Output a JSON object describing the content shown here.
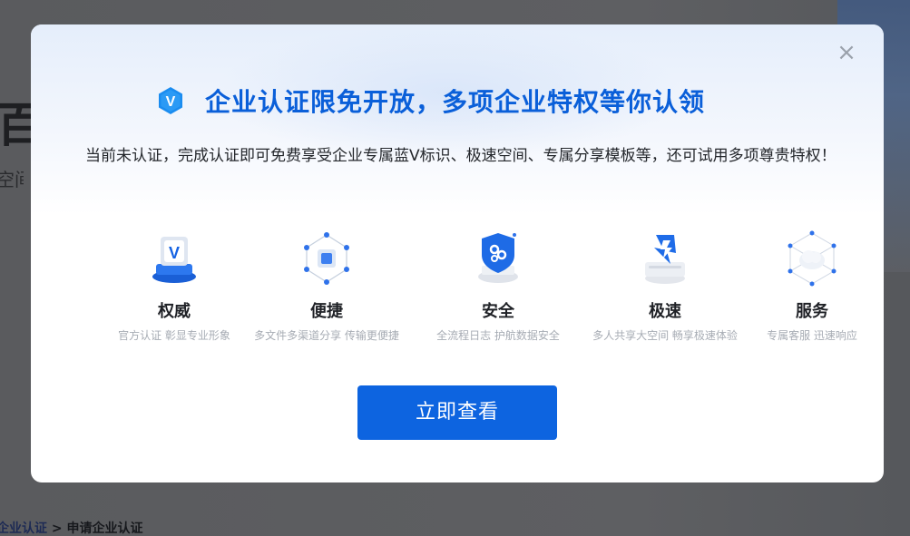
{
  "background": {
    "title_fragment": "百",
    "subtitle_fragment": "空间",
    "breadcrumb": {
      "link": "企业认证",
      "separator": " > ",
      "current": "申请企业认证"
    }
  },
  "modal": {
    "close_icon": "×",
    "badge_letter": "V",
    "title": "企业认证限免开放，多项企业特权等你认领",
    "description": "当前未认证，完成认证即可免费享受企业专属蓝V标识、极速空间、专属分享模板等，还可试用多项尊贵特权！",
    "features": [
      {
        "name": "权威",
        "desc": "官方认证 彰显专业形象",
        "icon": "verified-badge-icon"
      },
      {
        "name": "便捷",
        "desc": "多文件多渠道分享 传输更便捷",
        "icon": "network-cube-icon"
      },
      {
        "name": "安全",
        "desc": "全流程日志 护航数据安全",
        "icon": "shield-icon"
      },
      {
        "name": "极速",
        "desc": "多人共享大空间 畅享极速体验",
        "icon": "lightning-icon"
      },
      {
        "name": "服务",
        "desc": "专属客服 迅速响应",
        "icon": "cloud-service-icon"
      }
    ],
    "cta_label": "立即查看"
  },
  "colors": {
    "brand_blue": "#0a5fd9",
    "button_blue": "#0d64e0",
    "overlay": "#5d5e61"
  }
}
